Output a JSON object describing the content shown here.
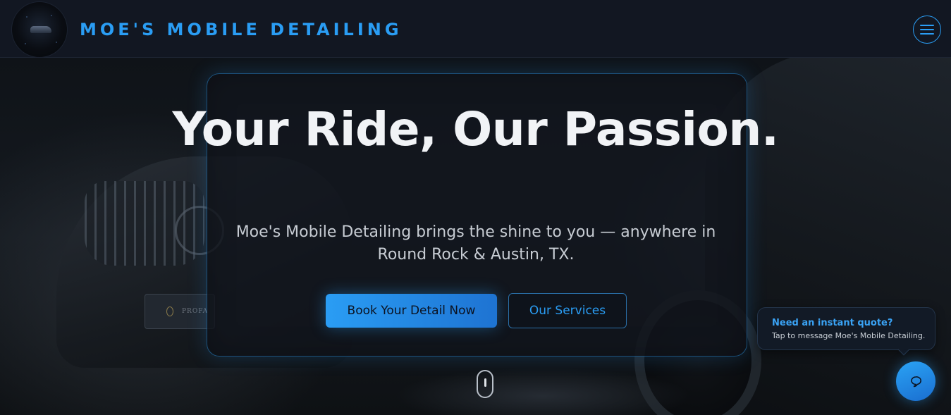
{
  "header": {
    "brand": "MOE'S MOBILE DETAILING",
    "logo_icon": "brand-logo-icon",
    "menu_icon": "hamburger-menu-icon"
  },
  "hero": {
    "title": "Your Ride, Our Passion.",
    "subtitle": "Moe's Mobile Detailing brings the shine to you — anywhere in Round Rock & Austin, TX.",
    "primary_cta": "Book Your Detail Now",
    "secondary_cta": "Our Services",
    "scroll_icon": "mouse-scroll-icon",
    "plate_text": "PROFA"
  },
  "chat": {
    "bubble_title": "Need an instant quote?",
    "bubble_text": "Tap to message Moe's Mobile Detailing.",
    "button_icon": "chat-icon"
  },
  "colors": {
    "accent": "#2a9df4",
    "header_bg": "#121722",
    "card_bg": "#12161e",
    "title_text": "#f1f3f6"
  }
}
